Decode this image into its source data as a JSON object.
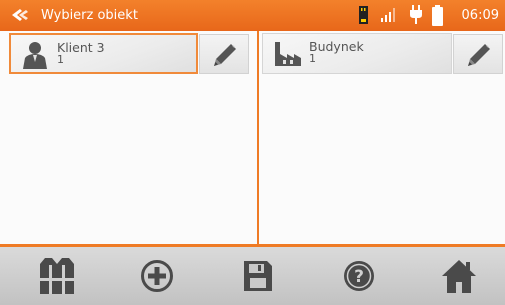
{
  "header": {
    "title": "Wybierz obiekt",
    "time": "06:09",
    "back_icon": "back-arrow-icon",
    "status_icons": [
      "memory-card-icon",
      "signal-icon",
      "plug-icon",
      "battery-icon"
    ]
  },
  "left_pane": {
    "item": {
      "name": "Klient 3",
      "count": "1",
      "icon": "person-icon"
    },
    "edit_icon": "pencil-icon"
  },
  "right_pane": {
    "item": {
      "name": "Budynek",
      "count": "1",
      "icon": "factory-icon"
    },
    "edit_icon": "pencil-icon"
  },
  "toolbar": {
    "buttons": [
      "vest-icon",
      "add-icon",
      "save-icon",
      "help-icon",
      "home-icon"
    ]
  },
  "colors": {
    "accent": "#ef7b25",
    "header": "#e8671a",
    "icon": "#555555"
  }
}
